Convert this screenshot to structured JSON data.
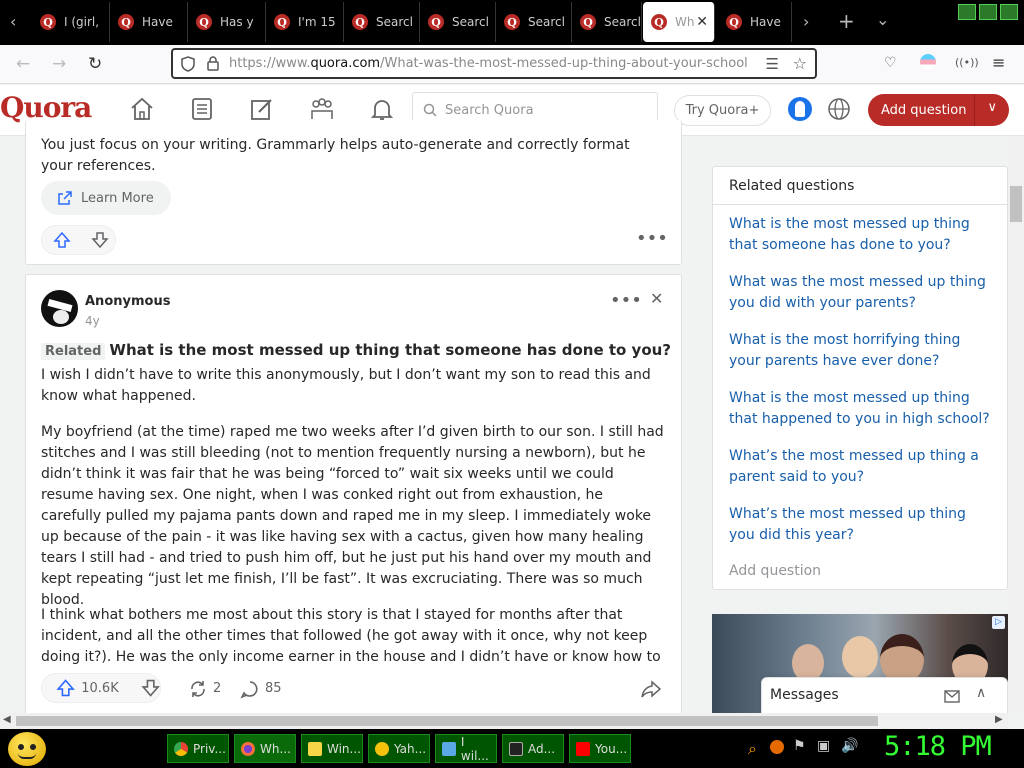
{
  "browser": {
    "tabs": [
      {
        "label": "I (girl,"
      },
      {
        "label": "Have"
      },
      {
        "label": "Has y"
      },
      {
        "label": "I'm 15"
      },
      {
        "label": "Searcl"
      },
      {
        "label": "Searcl"
      },
      {
        "label": "Searcl"
      },
      {
        "label": "Searcl"
      },
      {
        "label": "Wh"
      },
      {
        "label": "Have"
      }
    ],
    "url_prefix": "https://www.",
    "url_domain": "quora.com",
    "url_path": "/What-was-the-most-messed-up-thing-about-your-school"
  },
  "quora_nav": {
    "logo": "Quora",
    "search_placeholder": "Search Quora",
    "try_label": "Try Quora+",
    "add_question_label": "Add question"
  },
  "ad_card": {
    "text": "You just focus on your writing. Grammarly helps auto-generate and correctly format your references.",
    "learn_more": "Learn More"
  },
  "answer": {
    "author": "Anonymous",
    "age": "4y",
    "related_tag": "Related",
    "question": "What is the most messed up thing that someone has done to you?",
    "paragraphs": [
      "I wish I didn’t have to write this anonymously, but I don’t want my son to read this and know what happened.",
      "My boyfriend (at the time) raped me two weeks after I’d given birth to our son. I still had stitches and I was still bleeding (not to mention frequently nursing a newborn), but he didn’t think it was fair that he was being “forced to” wait six weeks until we could resume having sex. One night, when I was conked right out from exhaustion, he carefully pulled my pajama pants down and raped me in my sleep. I immediately woke up because of the pain - it was like having sex with a cactus, given how many healing tears I still had - and tried to push him off, but he just put his hand over my mouth and kept repeating “just let me finish, I’ll be fast”. It was excruciating. There was so much blood.",
      "I think what bothers me most about this story is that I stayed for months after that incident, and all the other times that followed (he got away with it once, why not keep doing it?). He was the only income earner in the house and I didn’t have or know how to obtain the resources"
    ],
    "upvotes": "10.6K",
    "shares": "2",
    "comments": "85"
  },
  "related": {
    "title": "Related questions",
    "questions": [
      "What is the most messed up thing that someone has done to you?",
      "What was the most messed up thing you did with your parents?",
      "What is the most horrifying thing your parents have ever done?",
      "What is the most messed up thing that happened to you in high school?",
      "What’s the most messed up thing a parent said to you?",
      "What’s the most messed up thing you did this year?"
    ],
    "add_question": "Add question"
  },
  "messages_label": "Messages",
  "taskbar": {
    "items": [
      {
        "label": "Priv..."
      },
      {
        "label": "Wh..."
      },
      {
        "label": "Win..."
      },
      {
        "label": "Yah..."
      },
      {
        "label": "I wil..."
      },
      {
        "label": "Ad..."
      },
      {
        "label": "You..."
      }
    ],
    "clock": "5:18 PM"
  }
}
